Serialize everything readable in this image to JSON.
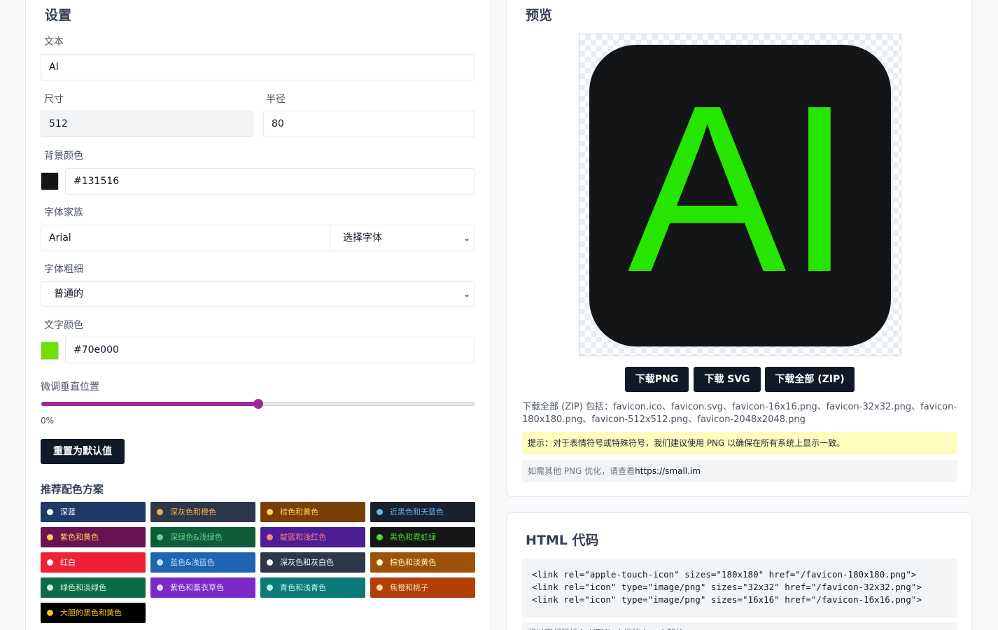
{
  "settings": {
    "title": "设置",
    "text_label": "文本",
    "text_value": "AI",
    "size_label": "尺寸",
    "size_value": "512",
    "radius_label": "半径",
    "radius_value": "80",
    "bg_color_label": "背景颜色",
    "bg_color_value": "#131516",
    "font_family_label": "字体家族",
    "font_family_value": "Arial",
    "font_select": "选择字体",
    "font_weight_label": "字体粗细",
    "font_weight_value": "普通的",
    "text_color_label": "文字颜色",
    "text_color_value": "#70e000",
    "vertical_label": "微调垂直位置",
    "vertical_value_text": "0%",
    "vertical_level": 0.5,
    "reset_button": "重置为默认值"
  },
  "schemes": {
    "title": "推荐配色方案",
    "items": [
      {
        "label": "深蓝",
        "bg": "#1e3a66",
        "fg": "#ffffff",
        "dot": "#ffffff"
      },
      {
        "label": "深灰色和橙色",
        "bg": "#2d3748",
        "fg": "#f6ad55",
        "dot": "#f6ad55"
      },
      {
        "label": "棕色和黄色",
        "bg": "#7a3e0b",
        "fg": "#fcd34d",
        "dot": "#fcd34d"
      },
      {
        "label": "近黑色和天蓝色",
        "bg": "#1a202c",
        "fg": "#63b3ed",
        "dot": "#63b3ed"
      },
      {
        "label": "紫色和黄色",
        "bg": "#6b1253",
        "fg": "#fcd34d",
        "dot": "#fcd34d"
      },
      {
        "label": "深绿色&浅绿色",
        "bg": "#0e5c3a",
        "fg": "#68d391",
        "dot": "#68d391"
      },
      {
        "label": "靛蓝和浅红色",
        "bg": "#4c1d95",
        "fg": "#fc8181",
        "dot": "#fc8181"
      },
      {
        "label": "黑色和霓虹绿",
        "bg": "#141617",
        "fg": "#48e020",
        "dot": "#48e020"
      },
      {
        "label": "红白",
        "bg": "#ef2235",
        "fg": "#ffffff",
        "dot": "#ffffff"
      },
      {
        "label": "蓝色&浅蓝色",
        "bg": "#1f64b0",
        "fg": "#bee3f8",
        "dot": "#bee3f8"
      },
      {
        "label": "深灰色和灰白色",
        "bg": "#2d3748",
        "fg": "#f7fafc",
        "dot": "#f7fafc"
      },
      {
        "label": "棕色和淡黄色",
        "bg": "#9c5208",
        "fg": "#fefcbf",
        "dot": "#fefcbf"
      },
      {
        "label": "绿色和淡绿色",
        "bg": "#0e6b48",
        "fg": "#c6f6d5",
        "dot": "#c6f6d5"
      },
      {
        "label": "紫色和薰衣草色",
        "bg": "#7b2ac9",
        "fg": "#e9d8fd",
        "dot": "#e9d8fd"
      },
      {
        "label": "青色和浅青色",
        "bg": "#0b7a78",
        "fg": "#b2f5ea",
        "dot": "#b2f5ea"
      },
      {
        "label": "焦橙和桃子",
        "bg": "#b23e0a",
        "fg": "#fed7aa",
        "dot": "#fed7aa"
      },
      {
        "label": "大胆的黑色和黄色",
        "bg": "#000000",
        "fg": "#fbbf24",
        "dot": "#fbbf24"
      }
    ]
  },
  "preview": {
    "title": "预览",
    "icon_text": "AI",
    "bg_color": "#131516",
    "text_color": "#26e600",
    "download_png": "下载PNG",
    "download_svg": "下载 SVG",
    "download_zip": "下载全部 (ZIP)",
    "zip_info_1": "下载全部 (ZIP) 包括：favicon.ico、favicon.svg、favicon-16x16.png、favicon-32x32.png、favicon-",
    "zip_info_2": "180x180.png、favicon-512x512.png、favicon-2048x2048.png",
    "tip": "提示：对于表情符号或特殊符号，我们建议使用 PNG 以确保在所有系统上显示一致。",
    "png_note": "如需其他 PNG 优化，请查看",
    "png_link": "https://small.im"
  },
  "code": {
    "title": "HTML 代码",
    "line1": "<link rel=\"apple-touch-icon\" sizes=\"180x180\" href=\"/favicon-180x180.png\">",
    "line2": "<link rel=\"icon\" type=\"image/png\" sizes=\"32x32\" href=\"/favicon-32x32.png\">",
    "line3": "<link rel=\"icon\" type=\"image/png\" sizes=\"16x16\" href=\"/favicon-16x16.png\">",
    "note": "将以下代码插入 HTML 文档的 head 部分"
  }
}
